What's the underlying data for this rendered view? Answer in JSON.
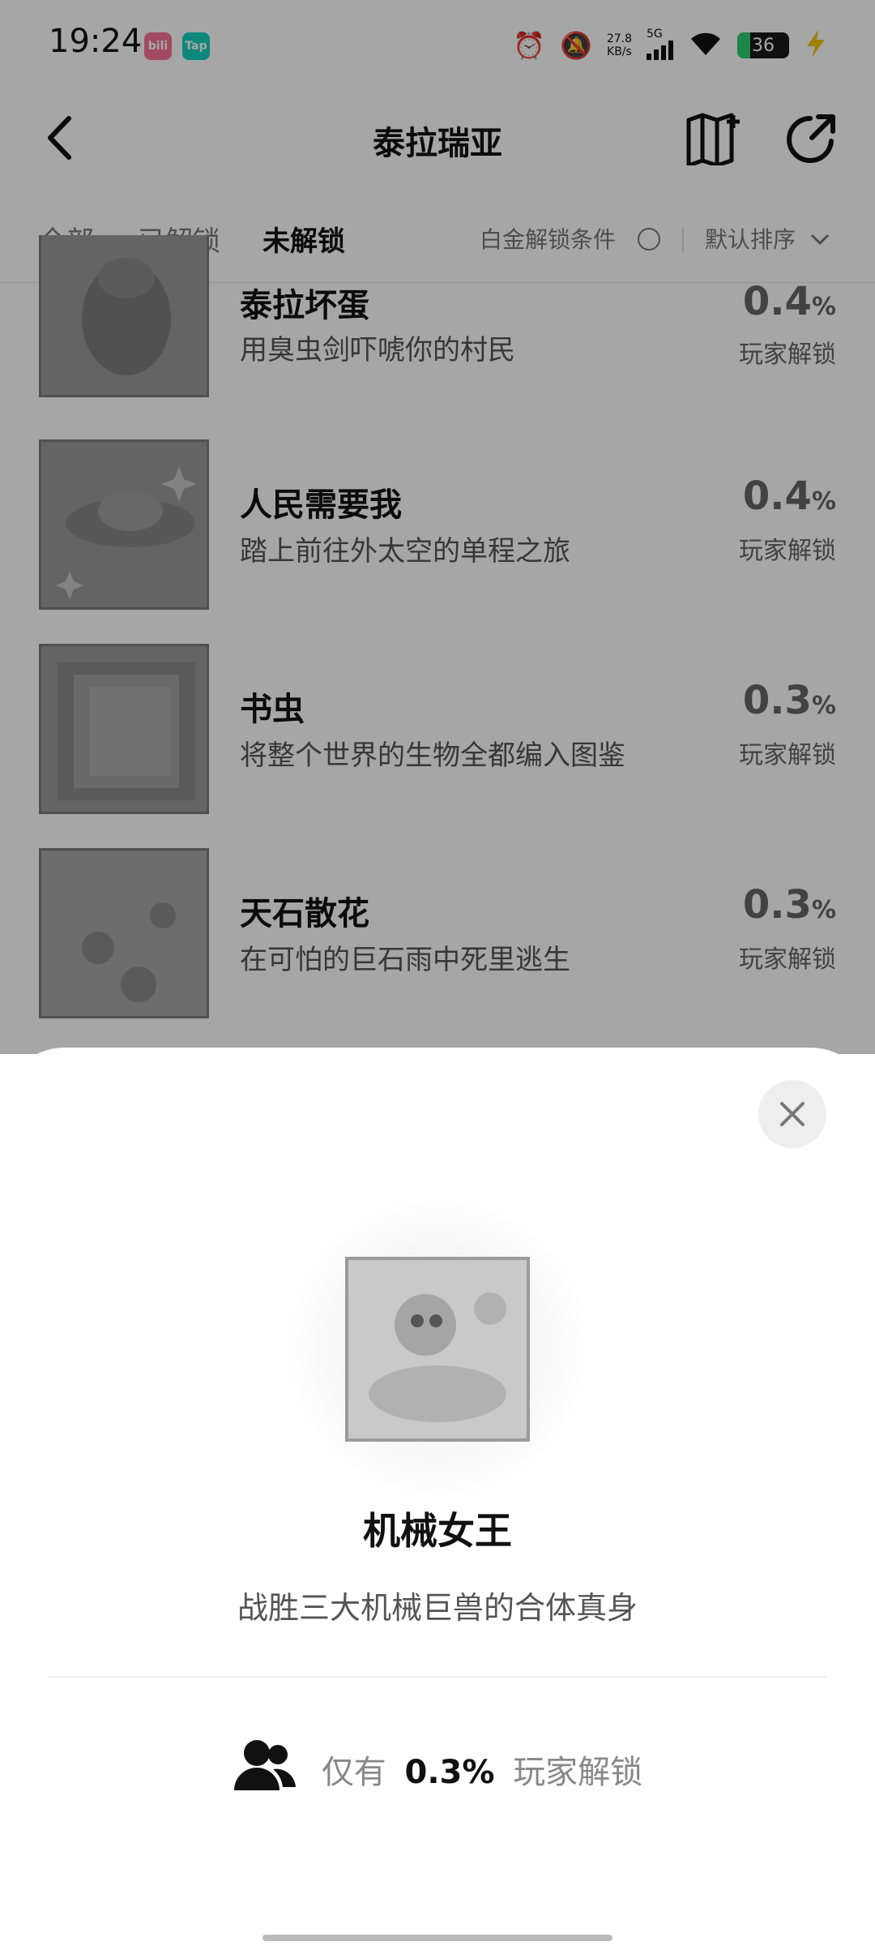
{
  "status_bar": {
    "time": "19:24",
    "badge1": "bili",
    "badge2": "Tap",
    "net_speed_value": "27.8",
    "net_speed_unit": "KB/s",
    "signal": "5G",
    "battery": "36",
    "colors": {
      "badge1": "#fb7299",
      "badge2": "#14d2c0",
      "battery_accent": "#2ecc71",
      "charge": "#f1c40f"
    }
  },
  "header": {
    "title": "泰拉瑞亚",
    "icons": [
      "back-arrow-icon",
      "map-add-icon",
      "share-icon"
    ]
  },
  "tabs": {
    "items": [
      "全部",
      "已解锁",
      "未解锁"
    ],
    "active_index": 2,
    "filter_label": "白金解锁条件",
    "sort_label": "默认排序"
  },
  "list": {
    "items": [
      {
        "title": "泰拉坏蛋",
        "desc": "用臭虫剑吓唬你的村民",
        "pct": "0.4",
        "pct_unit": "%",
        "label": "玩家解锁"
      },
      {
        "title": "人民需要我",
        "desc": "踏上前往外太空的单程之旅",
        "pct": "0.4",
        "pct_unit": "%",
        "label": "玩家解锁"
      },
      {
        "title": "书虫",
        "desc": "将整个世界的生物全都编入图鉴",
        "pct": "0.3",
        "pct_unit": "%",
        "label": "玩家解锁"
      },
      {
        "title": "天石散花",
        "desc": "在可怕的巨石雨中死里逃生",
        "pct": "0.3",
        "pct_unit": "%",
        "label": "玩家解锁"
      }
    ]
  },
  "sheet": {
    "title": "机械女王",
    "desc": "战胜三大机械巨兽的合体真身",
    "stat_prefix": "仅有",
    "stat_value": "0.3%",
    "stat_suffix": "玩家解锁"
  }
}
